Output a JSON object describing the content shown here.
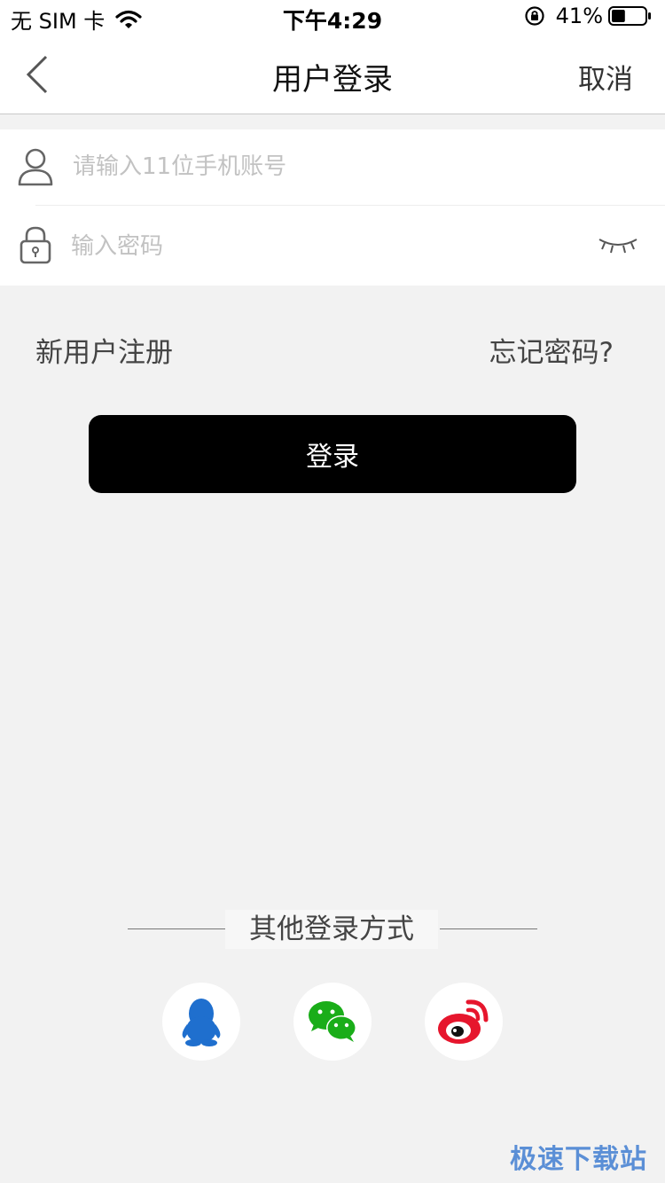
{
  "status_bar": {
    "carrier": "无 SIM 卡",
    "time": "下午4:29",
    "battery": "41%",
    "battery_level": 0.41
  },
  "nav": {
    "title": "用户登录",
    "cancel": "取消"
  },
  "form": {
    "account_placeholder": "请输入11位手机账号",
    "password_placeholder": "输入密码"
  },
  "links": {
    "register": "新用户注册",
    "forgot": "忘记密码?"
  },
  "login_button": "登录",
  "other_login": {
    "label": "其他登录方式",
    "methods": [
      "qq-icon",
      "wechat-icon",
      "weibo-icon"
    ]
  },
  "watermark": "极速下载站",
  "colors": {
    "background": "#f2f2f2",
    "button": "#000000",
    "qq": "#1f6fce",
    "wechat": "#1aad19",
    "weibo": "#e6162d",
    "watermark": "#5b8fd6"
  }
}
